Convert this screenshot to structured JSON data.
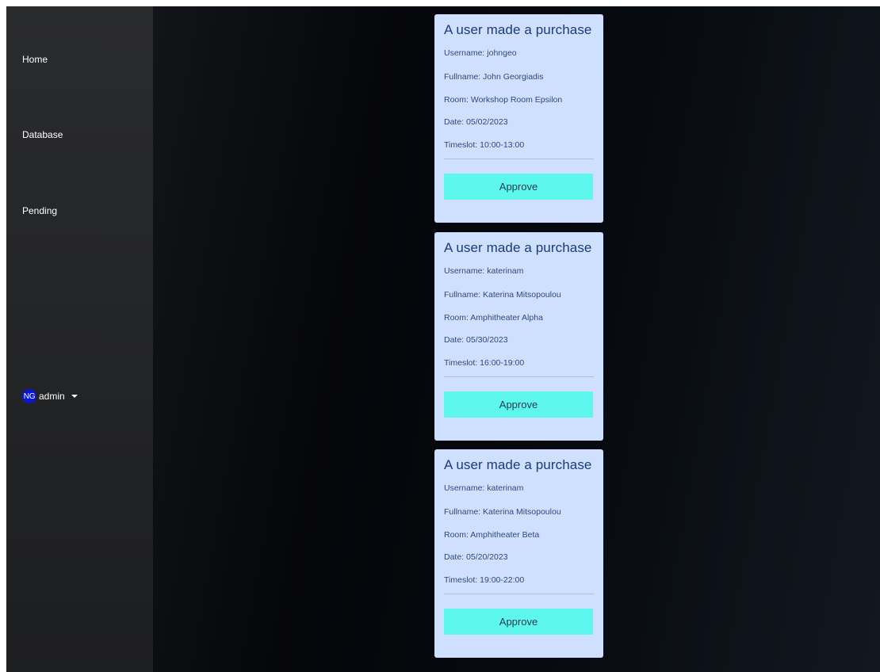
{
  "sidebar": {
    "items": [
      {
        "label": "Home"
      },
      {
        "label": "Database"
      },
      {
        "label": "Pending"
      }
    ],
    "user": {
      "initials": "NG",
      "name": "admin"
    }
  },
  "cards": [
    {
      "title": "A user made a purchase",
      "username": "Username: johngeo",
      "fullname": "Fullname: John Georgiadis",
      "room": "Room: Workshop Room Epsilon",
      "date": "Date: 05/02/2023",
      "timeslot": "Timeslot: 10:00-13:00",
      "button": "Approve"
    },
    {
      "title": "A user made a purchase",
      "username": "Username: katerinam",
      "fullname": "Fullname: Katerina Mitsopoulou",
      "room": "Room: Amphitheater Alpha",
      "date": "Date: 05/30/2023",
      "timeslot": "Timeslot: 16:00-19:00",
      "button": "Approve"
    },
    {
      "title": "A user made a purchase",
      "username": "Username: katerinam",
      "fullname": "Fullname: Katerina Mitsopoulou",
      "room": "Room: Amphitheater Beta",
      "date": "Date: 05/20/2023",
      "timeslot": "Timeslot: 19:00-22:00",
      "button": "Approve"
    }
  ],
  "colors": {
    "avatar": "#0a16d6",
    "card_background": "#cfe0ff",
    "card_title": "#1c3c78",
    "approve_button": "#5ef7ed"
  }
}
